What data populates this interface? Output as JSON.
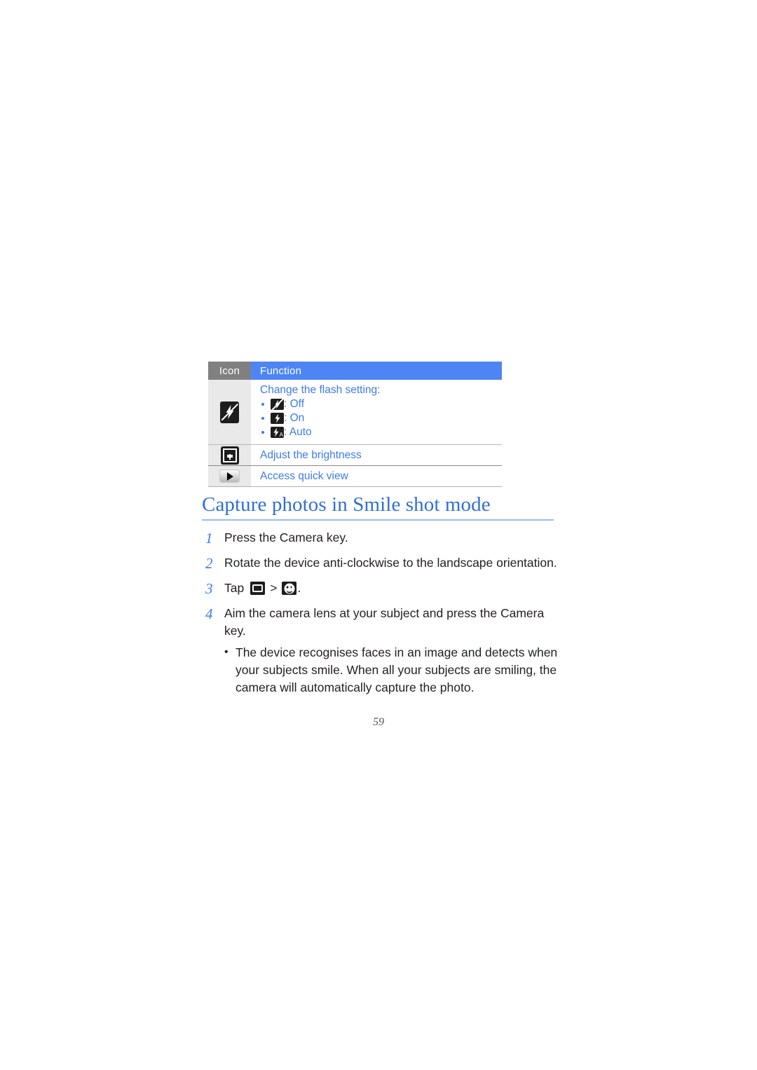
{
  "document": {
    "page_number": "59"
  },
  "table": {
    "headers": {
      "icon": "Icon",
      "function": "Function"
    },
    "rows": [
      {
        "icon_name": "flash-off-icon",
        "title": "Change the flash setting:",
        "options": [
          {
            "icon_name": "flash-off-icon",
            "label": ": Off"
          },
          {
            "icon_name": "flash-on-icon",
            "label": ": On"
          },
          {
            "icon_name": "flash-auto-icon",
            "label": ": Auto"
          }
        ]
      },
      {
        "icon_name": "brightness-icon",
        "title": "Adjust the brightness"
      },
      {
        "icon_name": "quick-view-icon",
        "title": "Access quick view"
      }
    ]
  },
  "section": {
    "heading": "Capture photos in Smile shot mode",
    "steps": [
      {
        "number": "1",
        "text": "Press the Camera key."
      },
      {
        "number": "2",
        "text": "Rotate the device anti-clockwise to the landscape orientation."
      },
      {
        "number": "3",
        "prefix": "Tap",
        "separator": ">",
        "suffix": ".",
        "icon_one": "shooting-mode-icon",
        "icon_two": "smile-shot-icon"
      },
      {
        "number": "4",
        "text": "Aim the camera lens at your subject and press the Camera key.",
        "bullets": [
          "The device recognises faces in an image and detects when your subjects smile. When all your subjects are smiling, the camera will automatically capture the photo."
        ]
      }
    ]
  },
  "colors": {
    "header_gray": "#808080",
    "header_blue": "#4d85f5",
    "body_blue": "#3d7ce8",
    "heading_blue": "#2f6fd8",
    "rule_blue": "#9dbdf2",
    "icon_cell_bg": "#e9e9e9",
    "text_black": "#231f20"
  }
}
